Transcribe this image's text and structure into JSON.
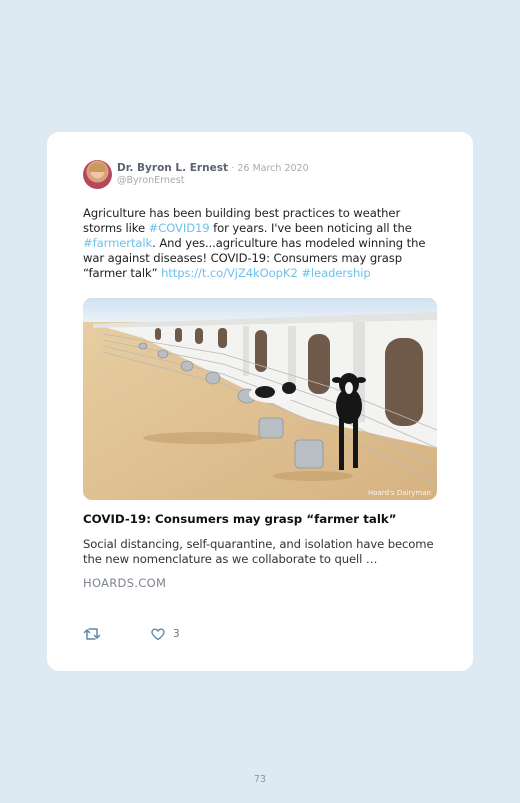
{
  "tweet": {
    "author_name": "Dr. Byron L. Ernest",
    "date": "· 26 March 2020",
    "handle": "@ByronErnest",
    "text_segments": [
      {
        "text": "Agriculture has been building best practices to weather storms like ",
        "link": false
      },
      {
        "text": "#COVID19",
        "link": true
      },
      {
        "text": " for years. I've been noticing all the ",
        "link": false
      },
      {
        "text": "#farmertalk",
        "link": true
      },
      {
        "text": ". And yes...agriculture has modeled winning the war against diseases! COVID-19: Consumers may grasp “farmer talk” ",
        "link": false
      },
      {
        "text": "https://t.co/VjZ4kOopK2",
        "link": true
      },
      {
        "text": " ",
        "link": false
      },
      {
        "text": "#leadership",
        "link": true
      }
    ],
    "link_color": "#6fc0ea",
    "image_watermark": "Hoard's Dairyman",
    "link_card": {
      "title": "COVID-19: Consumers may grasp “farmer talk”",
      "description": "Social distancing, self-quarantine, and isolation have become the new nomenclature as we collaborate to quell …",
      "domain": "HOARDS.COM"
    },
    "actions": {
      "retweet_icon": "retweet-icon",
      "like_icon": "heart-icon",
      "like_count": "3"
    }
  },
  "page_number": "73"
}
